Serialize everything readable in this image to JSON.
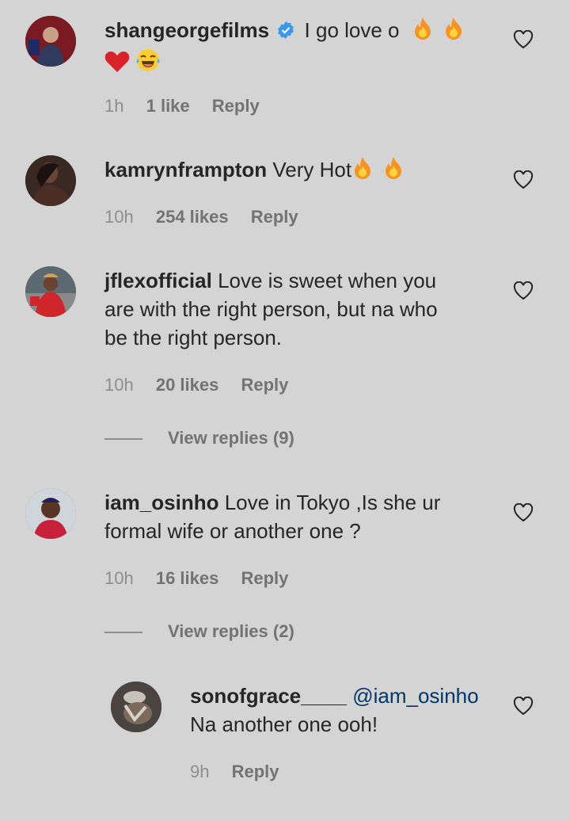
{
  "comments": [
    {
      "username": "shangeorgefilms",
      "verified": true,
      "text": "I go love o",
      "time": "1h",
      "likes": "1 like",
      "reply": "Reply"
    },
    {
      "username": "kamrynframpton",
      "text": "Very Hot",
      "time": "10h",
      "likes": "254 likes",
      "reply": "Reply"
    },
    {
      "username": "jflexofficial",
      "text_l1": "Love is sweet when you",
      "text_l2": "are with the right person, but na who",
      "text_l3": "be the right person.",
      "time": "10h",
      "likes": "20 likes",
      "reply": "Reply",
      "view_replies": "View replies (9)"
    },
    {
      "username": "iam_osinho",
      "text_l1": "Love in Tokyo ,Is she ur",
      "text_l2": "formal wife or another one ?",
      "time": "10h",
      "likes": "16 likes",
      "reply": "Reply",
      "view_replies": "View replies (2)"
    }
  ],
  "reply": {
    "username": "sonofgrace____",
    "mention": "@iam_osinho",
    "text": "Na another one ooh!",
    "time": "9h",
    "reply": "Reply"
  },
  "colors": {
    "background": "#d4d4d4",
    "text": "#262626",
    "meta": "#8e8e8e",
    "mention": "#00376b",
    "verified": "#3897f0"
  },
  "icons": [
    "heart-outline-icon",
    "verified-badge-icon",
    "fire-emoji",
    "red-heart-emoji",
    "laughing-tears-emoji"
  ]
}
